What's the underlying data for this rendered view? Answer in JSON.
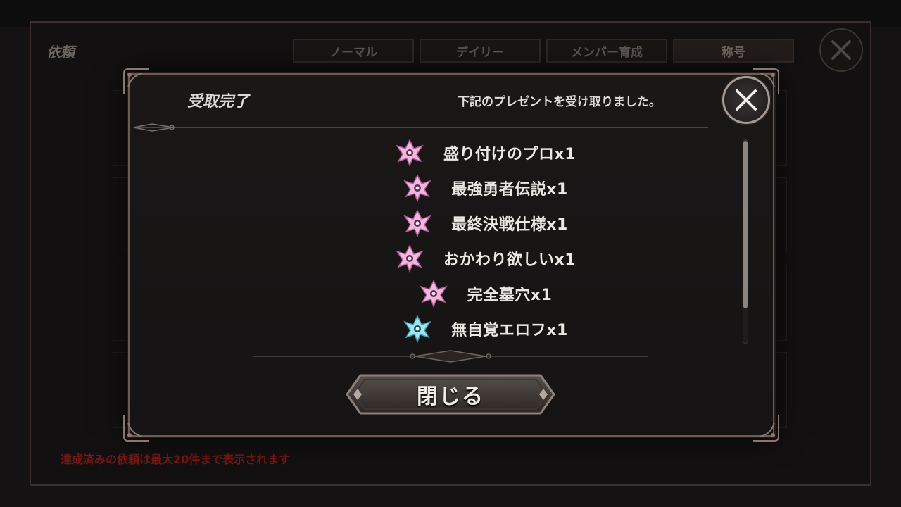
{
  "background": {
    "title": "依頼",
    "tabs": [
      {
        "label": "ノーマル"
      },
      {
        "label": "デイリー"
      },
      {
        "label": "メンバー育成"
      },
      {
        "label": "称号"
      }
    ],
    "note": "達成済みの依頼は最大20件まで表示されます"
  },
  "modal": {
    "title": "受取完了",
    "message": "下記のプレゼントを受け取りました。",
    "rewards": [
      {
        "label": "盛り付けのプロx1",
        "icon": "pink-title-emblem-icon"
      },
      {
        "label": "最強勇者伝説x1",
        "icon": "pink-title-emblem-icon"
      },
      {
        "label": "最終決戦仕様x1",
        "icon": "pink-title-emblem-icon"
      },
      {
        "label": "おかわり欲しいx1",
        "icon": "pink-title-emblem-icon"
      },
      {
        "label": "完全墓穴x1",
        "icon": "pink-title-emblem-icon"
      },
      {
        "label": "無自覚エロフx1",
        "icon": "blue-title-emblem-icon"
      }
    ],
    "close_button_label": "閉じる"
  },
  "colors": {
    "pink_emblem": "#f0b8dc",
    "blue_emblem": "#9fe4f2",
    "note_red": "#7a1712",
    "frame": "#6e5a55"
  }
}
